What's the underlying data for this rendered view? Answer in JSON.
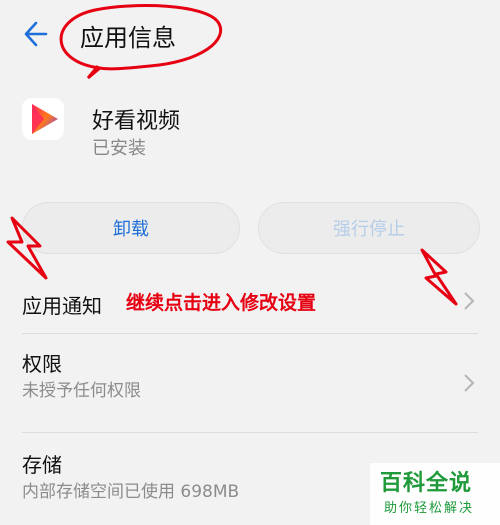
{
  "header": {
    "title": "应用信息"
  },
  "app": {
    "name": "好看视频",
    "status": "已安装"
  },
  "actions": {
    "uninstall": "卸载",
    "force_stop": "强行停止"
  },
  "rows": [
    {
      "title": "应用通知",
      "subtitle": ""
    },
    {
      "title": "权限",
      "subtitle": "未授予任何权限"
    },
    {
      "title": "存储",
      "subtitle": "内部存储空间已使用 698MB"
    }
  ],
  "annotation": {
    "text": "继续点击进入修改设置"
  },
  "watermark": {
    "title": "百科全说",
    "subtitle": "助你轻松解决"
  },
  "colors": {
    "accent": "#1f6fd9",
    "annotation": "#e60012",
    "watermark": "#1e9a3a"
  }
}
